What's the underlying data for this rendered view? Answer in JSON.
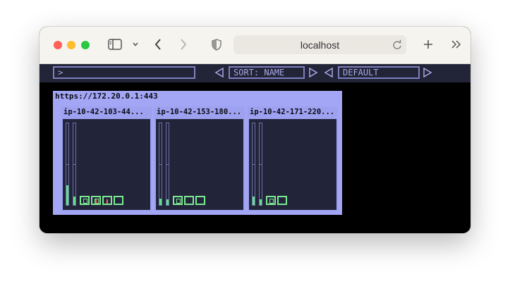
{
  "browser": {
    "url": "localhost"
  },
  "toolbar": {
    "filter_value": ">",
    "sort_label": "SORT: NAME",
    "view_label": "DEFAULT"
  },
  "cluster": {
    "title": "https://172.20.0.1:443",
    "nodes": [
      {
        "name": "ip-10-42-103-44...",
        "cpu_usage": 0.24,
        "mem_usage": 0.1,
        "pods": 4
      },
      {
        "name": "ip-10-42-153-180...",
        "cpu_usage": 0.08,
        "mem_usage": 0.07,
        "pods": 3
      },
      {
        "name": "ip-10-42-171-220...",
        "cpu_usage": 0.1,
        "mem_usage": 0.07,
        "pods": 2
      }
    ]
  },
  "colors": {
    "meter_fill": "#5fe08a",
    "pod_border": "#7ce892",
    "pod_activity": "#ff6060"
  },
  "icons": [
    "sidebar-icon",
    "chevron-down-icon",
    "back-icon",
    "forward-icon",
    "shield-icon",
    "reload-icon",
    "new-tab-icon",
    "more-icon"
  ]
}
